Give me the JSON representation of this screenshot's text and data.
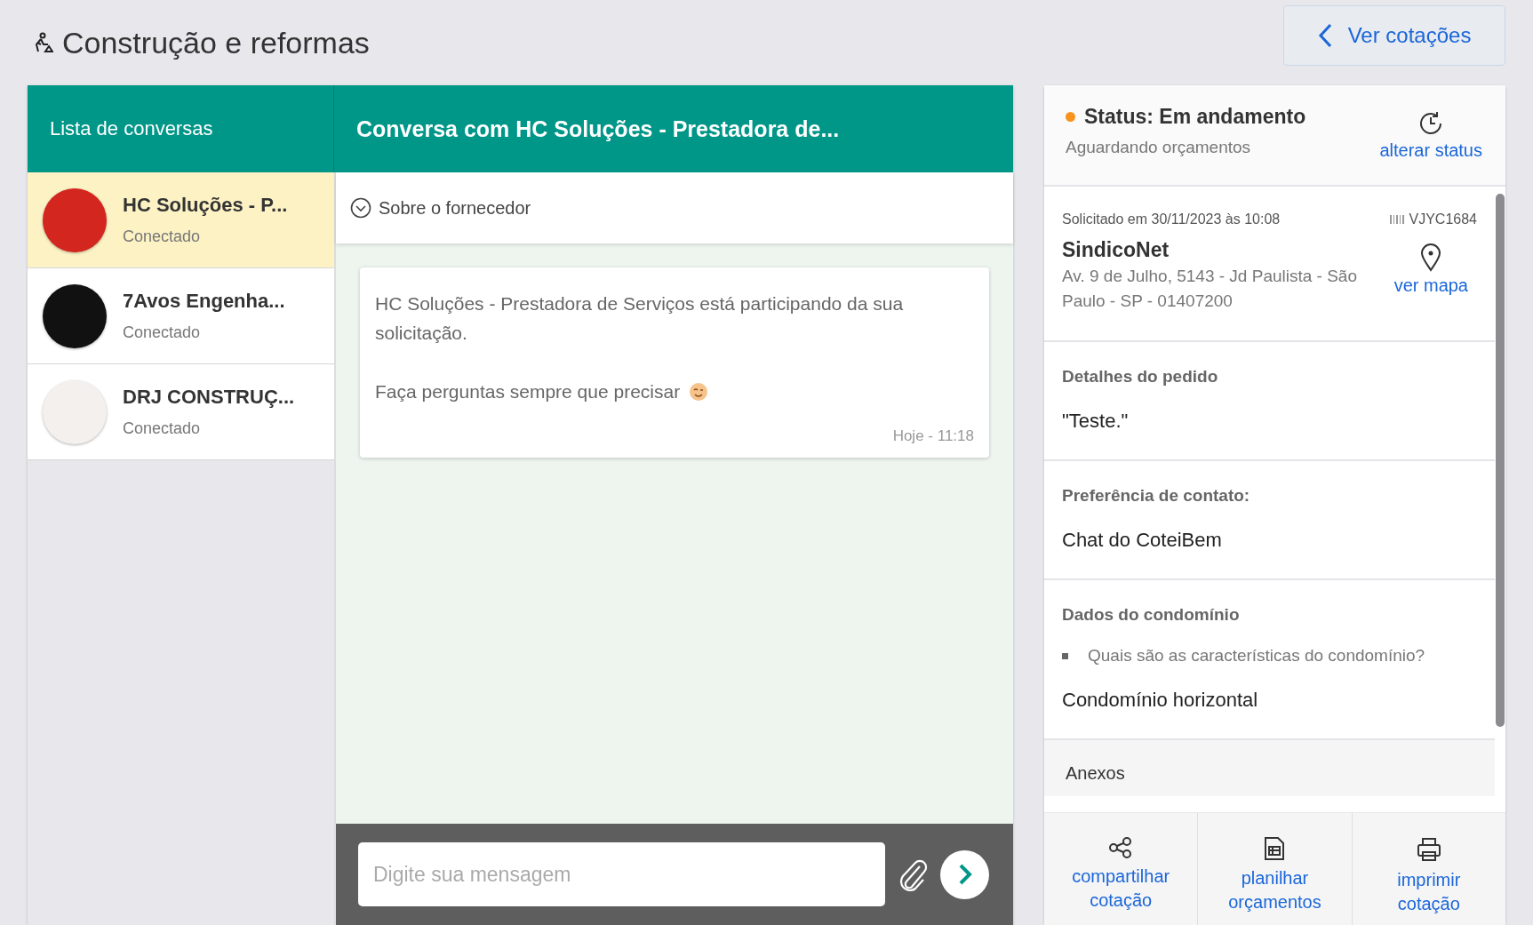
{
  "page": {
    "title": "Construção e reformas",
    "back_button": "Ver cotações"
  },
  "conversations": {
    "title": "Lista de conversas",
    "items": [
      {
        "name": "HC Soluções - P...",
        "status": "Conectado",
        "selected": true,
        "color": "#d3261f"
      },
      {
        "name": "7Avos Engenha...",
        "status": "Conectado",
        "selected": false,
        "color": "#111111"
      },
      {
        "name": "DRJ CONSTRUÇ...",
        "status": "Conectado",
        "selected": false,
        "color": "#f4f0ee"
      }
    ]
  },
  "chat": {
    "title": "Conversa com HC Soluções - Prestadora de...",
    "about": "Sobre o fornecedor",
    "messages": [
      {
        "paragraphs": [
          "HC Soluções - Prestadora de Serviços está participando da sua solicitação.",
          "Faça perguntas sempre que precisar"
        ],
        "time": "Hoje - 11:18"
      }
    ],
    "input": {
      "placeholder": "Digite sua mensagem"
    }
  },
  "details": {
    "status": {
      "label": "Status: Em andamento",
      "sub": "Aguardando orçamentos",
      "color": "#f7931e",
      "action": "alterar status"
    },
    "request": {
      "date": "Solicitado em 30/11/2023 às 10:08",
      "code": "VJYC1684",
      "name": "SindicoNet",
      "address": "Av. 9 de Julho, 5143 - Jd Paulista - São Paulo - SP - 01407200",
      "map_link": "ver mapa"
    },
    "sections": [
      {
        "kind": "text",
        "title": "Detalhes do pedido",
        "value": "\"Teste.\""
      },
      {
        "kind": "text",
        "title": "Preferência de contato:",
        "value": "Chat do CoteiBem"
      },
      {
        "kind": "qa",
        "title": "Dados do condomínio",
        "question": "Quais são as características do condomínio?",
        "value": "Condomínio horizontal"
      },
      {
        "kind": "header",
        "title": "Anexos"
      }
    ],
    "actions": [
      {
        "kind": "share",
        "label": "compartilhar cotação"
      },
      {
        "kind": "sheet",
        "label": "planilhar orçamentos"
      },
      {
        "kind": "print",
        "label": "imprimir cotação"
      }
    ]
  }
}
